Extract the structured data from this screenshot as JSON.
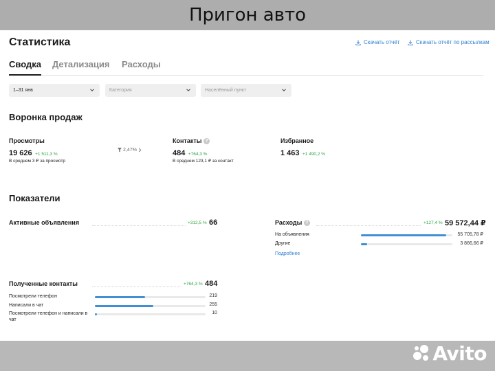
{
  "banner": {
    "title": "Пригон авто"
  },
  "header": {
    "title": "Статистика",
    "download_report": "Скачать отчёт",
    "download_mailing": "Скачать отчёт по рассылкам"
  },
  "tabs": [
    {
      "label": "Сводка",
      "active": true
    },
    {
      "label": "Детализация",
      "active": false
    },
    {
      "label": "Расходы",
      "active": false
    }
  ],
  "filters": {
    "period": "1–31 янв",
    "category_placeholder": "Категория",
    "city_placeholder": "Населённый пункт"
  },
  "funnel": {
    "title": "Воронка продаж",
    "views": {
      "label": "Просмотры",
      "value": "19 626",
      "delta": "+1 511,3 %",
      "avg": "В среднем 3 ₽ за просмотр"
    },
    "conversion": "2,47%",
    "contacts": {
      "label": "Контакты",
      "value": "484",
      "delta": "+764,3 %",
      "avg": "В среднем 123,1 ₽ за контакт"
    },
    "favorites": {
      "label": "Избранное",
      "value": "1 463",
      "delta": "+1 490,2 %"
    }
  },
  "indicators": {
    "title": "Показатели",
    "active_ads": {
      "label": "Активные объявления",
      "delta": "+312,5 %",
      "value": "66"
    },
    "expenses": {
      "label": "Расходы",
      "delta": "+127,4 %",
      "value": "59 572,44 ₽",
      "rows": [
        {
          "label": "На объявления",
          "value": "55 705,78 ₽",
          "fraction": 0.935
        },
        {
          "label": "Другие",
          "value": "3 866,66 ₽",
          "fraction": 0.065
        }
      ],
      "more": "Подробнее"
    },
    "received_contacts": {
      "label": "Полученные контакты",
      "delta": "+764,3 %",
      "value": "484",
      "rows": [
        {
          "label": "Посмотрели телефон",
          "value": "219",
          "fraction": 0.452
        },
        {
          "label": "Написали в чат",
          "value": "255",
          "fraction": 0.527
        },
        {
          "label": "Посмотрели телефон и написали в чат",
          "value": "10",
          "fraction": 0.021
        }
      ]
    }
  },
  "brand": {
    "logo_text": "Avito",
    "colors": [
      "#00aaff",
      "#97cf26",
      "#a169f7",
      "#ff6163"
    ]
  },
  "colors": {
    "accent": "#3f8fd6",
    "positive": "#2ea644"
  }
}
